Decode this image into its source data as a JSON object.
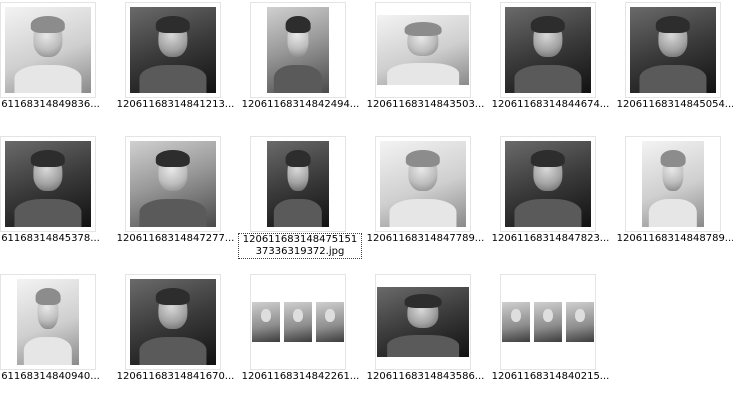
{
  "files": [
    {
      "label": "61168314849836...",
      "tone": "light",
      "shape": "normal"
    },
    {
      "label": "120611683148412 13...",
      "tone": "dark",
      "shape": "normal"
    },
    {
      "label": "12061168314842494...",
      "tone": "normal",
      "shape": "tall"
    },
    {
      "label": "12061168314843503...",
      "tone": "light",
      "shape": "wide"
    },
    {
      "label": "12061168314844674...",
      "tone": "dark",
      "shape": "normal"
    },
    {
      "label": "12061168314845054...",
      "tone": "dark",
      "shape": "normal"
    },
    {
      "label": "61168314845378...",
      "tone": "dark",
      "shape": "normal"
    },
    {
      "label": "12061168314847277...",
      "tone": "normal",
      "shape": "normal"
    },
    {
      "label": "12061168314847515137336319372.jpg",
      "tone": "dark",
      "shape": "tall",
      "selected": true
    },
    {
      "label": "12061168314847789...",
      "tone": "light",
      "shape": "normal"
    },
    {
      "label": "12061168314847823...",
      "tone": "dark",
      "shape": "normal"
    },
    {
      "label": "12061168314848789...",
      "tone": "light",
      "shape": "tall"
    },
    {
      "label": "61168314840940...",
      "tone": "light",
      "shape": "tall"
    },
    {
      "label": "12061168314841670...",
      "tone": "dark",
      "shape": "normal"
    },
    {
      "label": "12061168314842261...",
      "tone": "normal",
      "shape": "triptych"
    },
    {
      "label": "12061168314843586...",
      "tone": "dark",
      "shape": "wide"
    },
    {
      "label": "12061168314840215...",
      "tone": "normal",
      "shape": "triptych"
    }
  ]
}
